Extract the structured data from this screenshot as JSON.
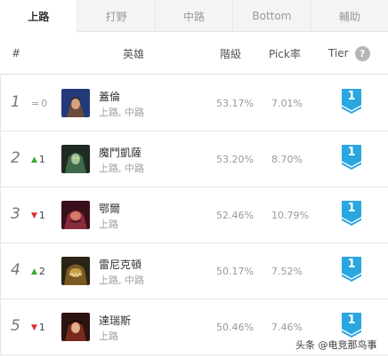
{
  "tabs": [
    {
      "label": "上路",
      "active": true
    },
    {
      "label": "打野",
      "active": false
    },
    {
      "label": "中路",
      "active": false
    },
    {
      "label": "Bottom",
      "active": false
    },
    {
      "label": "輔助",
      "active": false
    }
  ],
  "table_head": {
    "num": "#",
    "hero": "英雄",
    "winrate": "階級",
    "pickrate": "Pick率",
    "tier": "Tier",
    "help": "?"
  },
  "rows": [
    {
      "rank": "1",
      "trend": "same",
      "trend_arrow": "=",
      "trend_num": "0",
      "name": "蓋倫",
      "roles": "上路, 中路",
      "winrate": "53.17%",
      "pickrate": "7.01%",
      "tier": "1",
      "portrait": [
        "#233a7a",
        "#6a4a3a",
        "#d9a27a"
      ]
    },
    {
      "rank": "2",
      "trend": "up",
      "trend_arrow": "▲",
      "trend_num": "1",
      "name": "魔鬥凱薩",
      "roles": "上路, 中路",
      "winrate": "53.20%",
      "pickrate": "8.70%",
      "tier": "1",
      "portrait": [
        "#1e2a22",
        "#3f6a4a",
        "#a7c39a"
      ]
    },
    {
      "rank": "3",
      "trend": "down",
      "trend_arrow": "▼",
      "trend_num": "1",
      "name": "鄂爾",
      "roles": "上路",
      "winrate": "52.46%",
      "pickrate": "10.79%",
      "tier": "1",
      "portrait": [
        "#3a0f1c",
        "#8a2b3a",
        "#d77a6a"
      ]
    },
    {
      "rank": "4",
      "trend": "up",
      "trend_arrow": "▲",
      "trend_num": "2",
      "name": "雷尼克頓",
      "roles": "上路, 中路",
      "winrate": "50.17%",
      "pickrate": "7.52%",
      "tier": "1",
      "portrait": [
        "#2a2414",
        "#7a5a22",
        "#c9a04a"
      ]
    },
    {
      "rank": "5",
      "trend": "down",
      "trend_arrow": "▼",
      "trend_num": "1",
      "name": "達瑞斯",
      "roles": "上路",
      "winrate": "50.46%",
      "pickrate": "7.46%",
      "tier": "1",
      "portrait": [
        "#2c1410",
        "#7a2a1c",
        "#e0b08a"
      ]
    }
  ],
  "colors": {
    "tier_badge": "#2aa6e0"
  },
  "watermark": "头条 @电竞那鸟事"
}
